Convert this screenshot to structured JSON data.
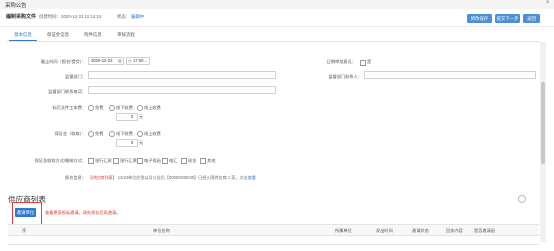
{
  "window": {
    "title": "采购公告",
    "close": "×"
  },
  "doc": {
    "title": "编制采购文件",
    "created_label": "创建时间：",
    "created_value": "2020-12-23 11:14:15",
    "status_label": "状态：",
    "status_value": "编辑中"
  },
  "toolbar": {
    "btn1": "修改保存",
    "btn2": "提交下一步",
    "btn3": "返回"
  },
  "tabs": [
    "基本信息",
    "保证金信息",
    "附件信息",
    "审核流程"
  ],
  "form": {
    "deadline_label": "截止时间（报名/提交）：",
    "deadline_date": "2020-12-23",
    "deadline_time": "17:00",
    "reviewer_label": "日期审批意见：",
    "reviewer_option": "是",
    "dept_label": "监督部门：",
    "dept_contact_label": "监督部门联系人：",
    "dept_phone_label": "监督部门联系电话：",
    "file_fee_label": "标后文件工本费：",
    "fee_options": [
      "免费",
      "线下收费",
      "线上收费"
    ],
    "file_fee_value": "0",
    "file_fee_unit": "元",
    "deposit_label": "保证金（收取）：",
    "deposit_options": [
      "免费",
      "线下收费",
      "线上收费"
    ],
    "deposit_value": "0",
    "deposit_unit": "元",
    "pay_label": "保证金收取方式/缴纳方式：",
    "pay_options": [
      "银行汇款",
      "银行汇票",
      "电子保函",
      "电汇",
      "现金",
      "其他"
    ],
    "hint_label": "报名信息：",
    "hint_red": "【供应商列表】",
    "hint_text": " 12/23单位应答以及公告后【0000/0000/00】已经入围供应商 1 家，点击",
    "hint_link": "查看"
  },
  "section": {
    "title": "供应商列表",
    "add_button": "邀请单位",
    "warning": "查看更多投标邀请。请先保存后再邀请。",
    "columns": [
      "序",
      "单位名称",
      "所属单位",
      "发出时间",
      "邀请状态",
      "回执内容",
      "是否邀请函"
    ]
  }
}
